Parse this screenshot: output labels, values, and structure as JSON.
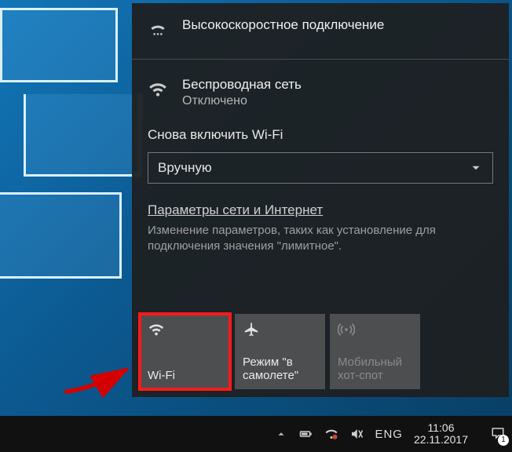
{
  "flyout": {
    "broadband": {
      "title": "Высокоскоростное подключение"
    },
    "wifi": {
      "title": "Беспроводная сеть",
      "status": "Отключено"
    },
    "reenable_label": "Снова включить Wi-Fi",
    "select_value": "Вручную",
    "settings_link": "Параметры сети и Интернет",
    "settings_hint": "Изменение параметров, таких как установление для подключения значения \"лимитное\"."
  },
  "tiles": {
    "wifi": "Wi-Fi",
    "airplane": "Режим \"в самолете\"",
    "hotspot": "Мобильный хот-спот"
  },
  "tray": {
    "lang": "ENG",
    "time": "11:06",
    "date": "22.11.2017",
    "badge": "1"
  }
}
